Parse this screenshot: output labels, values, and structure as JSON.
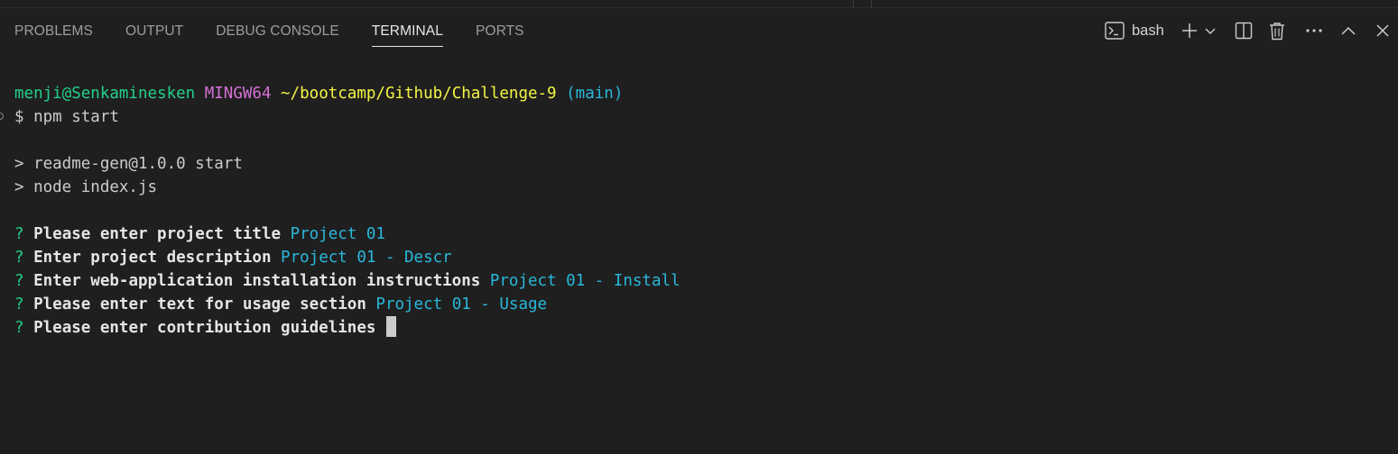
{
  "panel": {
    "tabs": [
      {
        "label": "PROBLEMS"
      },
      {
        "label": "OUTPUT"
      },
      {
        "label": "DEBUG CONSOLE"
      },
      {
        "label": "TERMINAL",
        "active": true
      },
      {
        "label": "PORTS"
      }
    ],
    "terminal_profile": "bash",
    "icons": {
      "terminal": "terminal-icon",
      "add": "plus-icon",
      "dropdown": "chevron-down-icon",
      "split": "split-icon",
      "kill": "trash-icon",
      "more": "ellipsis-icon",
      "maximize": "chevron-up-icon",
      "close": "close-icon"
    }
  },
  "terminal": {
    "prompt": {
      "user_host": "menji@Senkaminesken",
      "system": "MINGW64",
      "path": "~/bootcamp/Github/Challenge-9",
      "branch": "(main)"
    },
    "command_line": "$ npm start",
    "script_output": [
      "> readme-gen@1.0.0 start",
      "> node index.js"
    ],
    "questions": [
      {
        "mark": "?",
        "question": "Please enter project title",
        "answer": "Project 01"
      },
      {
        "mark": "?",
        "question": "Enter project description",
        "answer": "Project 01 - Descr"
      },
      {
        "mark": "?",
        "question": "Enter web-application installation instructions",
        "answer": "Project 01 - Install"
      },
      {
        "mark": "?",
        "question": "Please enter text for usage section",
        "answer": "Project 01 - Usage"
      },
      {
        "mark": "?",
        "question": "Please enter contribution guidelines",
        "answer": ""
      }
    ]
  },
  "colors": {
    "background": "#1f1f1f",
    "user_host": "#23d18b",
    "system": "#d670d6",
    "path": "#f5f543",
    "branch": "#29b8db",
    "question_mark": "#23d18b",
    "answer": "#29b8db"
  }
}
